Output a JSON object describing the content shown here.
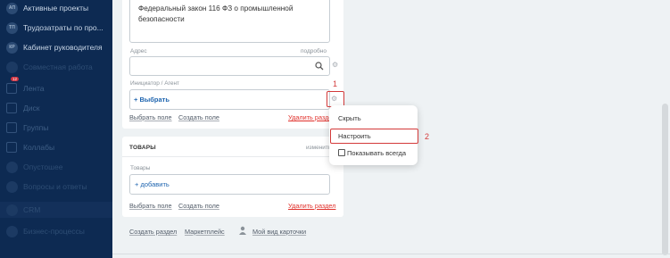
{
  "sidebar": {
    "items": [
      {
        "icon": "АП",
        "label": "Активные проекты"
      },
      {
        "icon": "ТП",
        "label": "Трудозатраты по про..."
      },
      {
        "icon": "КР",
        "label": "Кабинет руководителя"
      },
      {
        "icon": "",
        "label": "Совместная работа"
      },
      {
        "icon": "",
        "label": "Лента",
        "badge": "12"
      },
      {
        "icon": "",
        "label": "Диск"
      },
      {
        "icon": "",
        "label": "Группы"
      },
      {
        "icon": "",
        "label": "Коллабы"
      },
      {
        "icon": "",
        "label": "Опустошее"
      },
      {
        "icon": "",
        "label": "Вопросы и ответы"
      },
      {
        "icon": "",
        "label": "CRM"
      },
      {
        "icon": "",
        "label": "Бизнес-процессы"
      }
    ]
  },
  "form": {
    "law_text": "Федеральный закон 116 ФЗ о промышленной безопасности",
    "address_label": "Адрес",
    "address_detail_link": "подробно",
    "initiator_label": "Инициатор / Агент",
    "select_button": "+ Выбрать",
    "select_field_link": "Выбрать поле",
    "create_field_link": "Создать поле",
    "delete_section_link": "Удалить раздел"
  },
  "goods_section": {
    "title": "ТОВАРЫ",
    "edit_link": "изменить",
    "goods_label": "Товары",
    "add_button": "+ добавить",
    "select_field_link": "Выбрать поле",
    "create_field_link": "Создать поле",
    "delete_section_link": "Удалить раздел"
  },
  "footer": {
    "create_section": "Создать раздел",
    "marketplace": "Маркетплейс",
    "my_card_view": "Мой вид карточки"
  },
  "context_menu": {
    "hide": "Скрыть",
    "configure": "Настроить",
    "always_show": "Показывать всегда"
  },
  "annotations": {
    "step1": "1",
    "step2": "2",
    "color": "#d33a3a"
  }
}
